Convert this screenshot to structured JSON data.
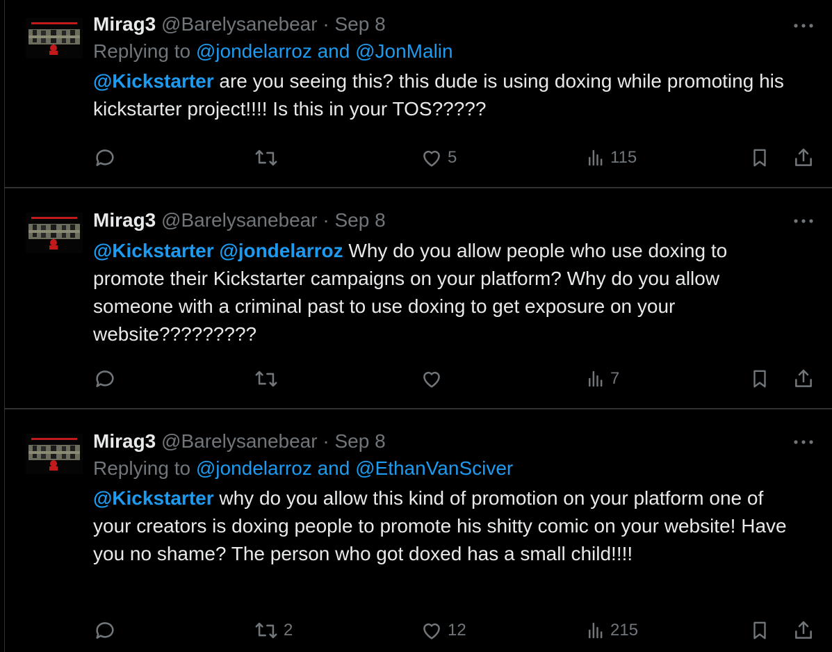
{
  "colors": {
    "background": "#000000",
    "text": "#e7e9ea",
    "muted": "#71767b",
    "link": "#1d9bf0",
    "divider": "#2f3336"
  },
  "tweets": [
    {
      "name": "Mirag3",
      "handle": "@Barelysanebear",
      "separator": "·",
      "date": "Sep 8",
      "reply_prefix": "Replying to ",
      "reply_to_1": "@jondelarroz",
      "reply_and": " and ",
      "reply_to_2": "@JonMalin",
      "mention_1": "@Kickstarter",
      "text": " are you seeing this? this dude is using doxing while promoting his kickstarter project!!!! Is this in your TOS?????",
      "reply_count": "",
      "retweet_count": "",
      "like_count": "5",
      "view_count": "115"
    },
    {
      "name": "Mirag3",
      "handle": "@Barelysanebear",
      "separator": "·",
      "date": "Sep 8",
      "mention_1": "@Kickstarter",
      "mention_2": "@jondelarroz",
      "text": "  Why do you allow people who use doxing to promote their Kickstarter campaigns on your platform? Why do you allow someone with a criminal past to use doxing to get exposure on your website?????????",
      "reply_count": "",
      "retweet_count": "",
      "like_count": "",
      "view_count": "7"
    },
    {
      "name": "Mirag3",
      "handle": "@Barelysanebear",
      "separator": "·",
      "date": "Sep 8",
      "reply_prefix": "Replying to ",
      "reply_to_1": "@jondelarroz",
      "reply_and": " and ",
      "reply_to_2": "@EthanVanSciver",
      "mention_1": "@Kickstarter",
      "text": "  why do you allow this kind of promotion on your platform one of your creators is doxing people to promote his shitty comic on your website! Have you no shame? The person who got doxed has a small child!!!!",
      "reply_count": "",
      "retweet_count": "2",
      "like_count": "12",
      "view_count": "215"
    }
  ],
  "icons": {
    "avatar": "band-logo-avatar",
    "more": "more-horizontal-icon",
    "reply": "reply-icon",
    "retweet": "retweet-icon",
    "like": "heart-icon",
    "views": "views-bar-chart-icon",
    "bookmark": "bookmark-icon",
    "share": "share-icon"
  }
}
